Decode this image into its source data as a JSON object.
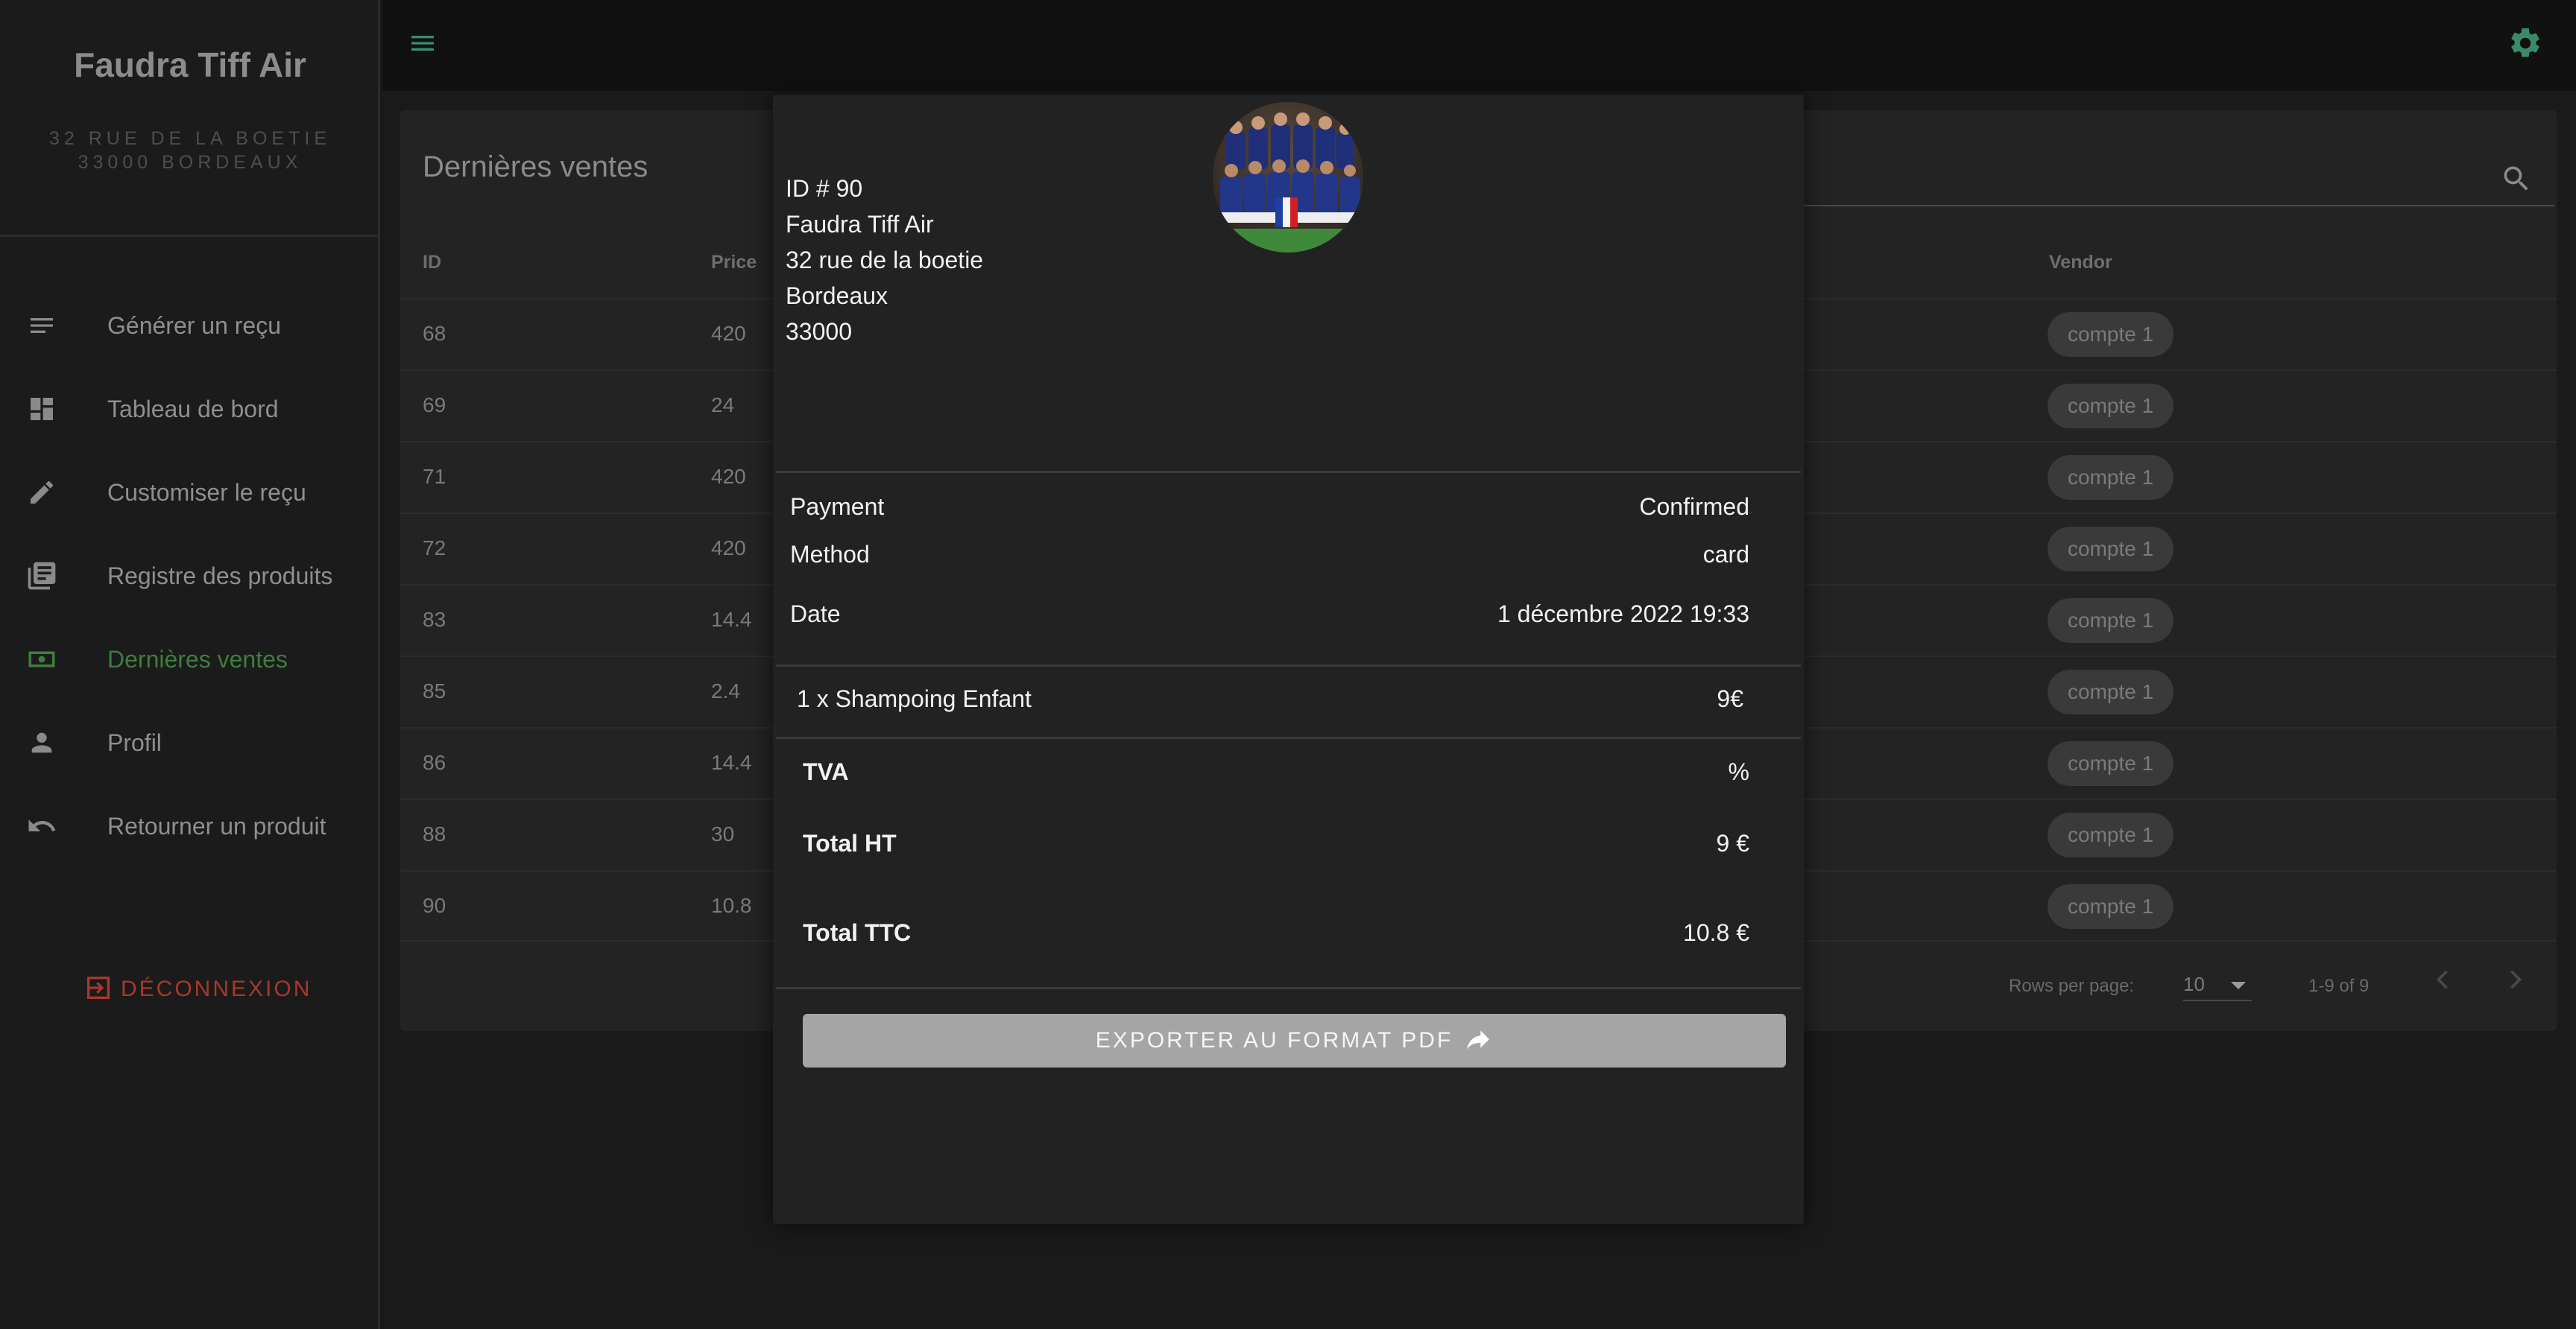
{
  "sidebar": {
    "brand": "Faudra Tiff Air",
    "address_line1": "32 RUE DE LA BOETIE",
    "address_line2": "33000 BORDEAUX",
    "items": [
      {
        "label": "Générer un reçu",
        "icon": "notes-icon"
      },
      {
        "label": "Tableau de bord",
        "icon": "dashboard-icon"
      },
      {
        "label": "Customiser le reçu",
        "icon": "pencil-icon"
      },
      {
        "label": "Registre des produits",
        "icon": "library-books-icon"
      },
      {
        "label": "Dernières ventes",
        "icon": "money-icon",
        "active": true
      },
      {
        "label": "Profil",
        "icon": "person-icon"
      },
      {
        "label": "Retourner un produit",
        "icon": "undo-icon"
      }
    ],
    "logout_label": "DÉCONNEXION"
  },
  "colors": {
    "accent_green": "#3f7d3f",
    "logout_red": "#a8382c",
    "gear_teal": "#3a8a6a",
    "menu_teal": "#3e8a74"
  },
  "main": {
    "title": "Dernières ventes",
    "columns": {
      "id": "ID",
      "price": "Price",
      "vendor": "Vendor"
    },
    "rows": [
      {
        "id": "68",
        "price": "420",
        "vendor": "compte 1"
      },
      {
        "id": "69",
        "price": "24",
        "vendor": "compte 1"
      },
      {
        "id": "71",
        "price": "420",
        "vendor": "compte 1"
      },
      {
        "id": "72",
        "price": "420",
        "vendor": "compte 1"
      },
      {
        "id": "83",
        "price": "14.4",
        "vendor": "compte 1"
      },
      {
        "id": "85",
        "price": "2.4",
        "vendor": "compte 1"
      },
      {
        "id": "86",
        "price": "14.4",
        "vendor": "compte 1"
      },
      {
        "id": "88",
        "price": "30",
        "vendor": "compte 1"
      },
      {
        "id": "90",
        "price": "10.8",
        "vendor": "compte 1"
      }
    ],
    "pagination": {
      "rows_per_page_label": "Rows per page:",
      "rows_per_page_value": "10",
      "range": "1-9 of 9"
    }
  },
  "receipt": {
    "id_line": "ID # 90",
    "company": "Faudra Tiff Air",
    "street": "32 rue de la boetie",
    "city": "Bordeaux",
    "zip": "33000",
    "payment_label": "Payment",
    "payment_value": "Confirmed",
    "method_label": "Method",
    "method_value": "card",
    "date_label": "Date",
    "date_value": "1 décembre 2022 19:33",
    "item_line": "1 x Shampoing Enfant",
    "item_price": "9€",
    "tva_label": "TVA",
    "tva_value": "%",
    "total_ht_label": "Total HT",
    "total_ht_value": "9 €",
    "total_ttc_label": "Total TTC",
    "total_ttc_value": "10.8 €",
    "export_label": "EXPORTER AU FORMAT PDF"
  }
}
